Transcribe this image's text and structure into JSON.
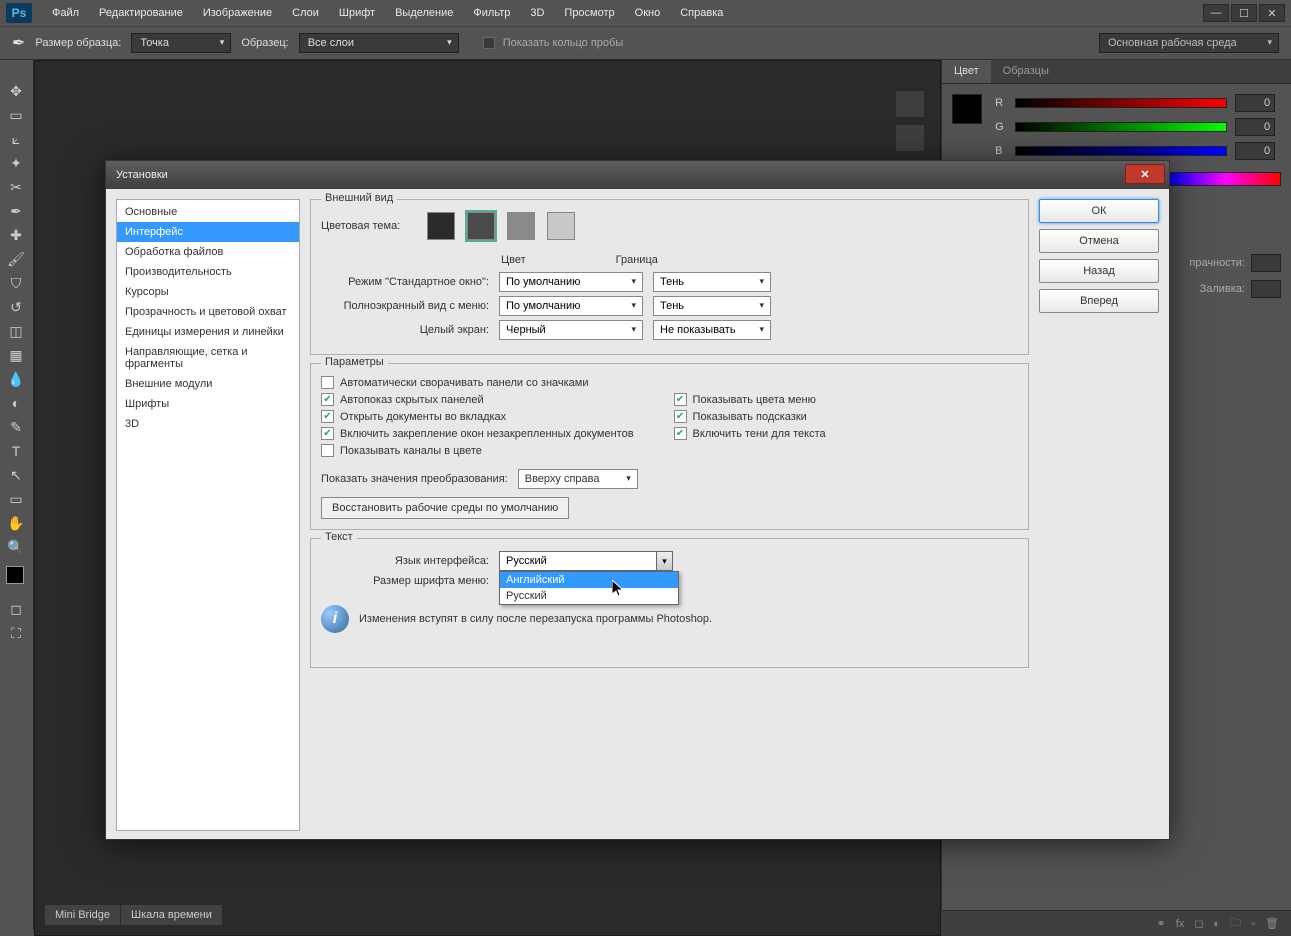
{
  "app": {
    "logo": "Ps"
  },
  "menubar": [
    "Файл",
    "Редактирование",
    "Изображение",
    "Слои",
    "Шрифт",
    "Выделение",
    "Фильтр",
    "3D",
    "Просмотр",
    "Окно",
    "Справка"
  ],
  "optionsbar": {
    "sample_size_label": "Размер образца:",
    "sample_size_value": "Точка",
    "sample_label": "Образец:",
    "sample_value": "Все слои",
    "show_ring_label": "Показать кольцо пробы",
    "workspace_label": "Основная рабочая среда"
  },
  "rightpanel": {
    "tabs": {
      "color": "Цвет",
      "swatches": "Образцы"
    },
    "r_label": "R",
    "g_label": "G",
    "b_label": "B",
    "r_val": "0",
    "g_val": "0",
    "b_val": "0",
    "layers": {
      "opacity_label": "прачности:",
      "fill_label": "Заливка:"
    }
  },
  "bottom_tabs": {
    "mini_bridge": "Mini Bridge",
    "timeline": "Шкала времени"
  },
  "dialog": {
    "title": "Установки",
    "categories": [
      "Основные",
      "Интерфейс",
      "Обработка файлов",
      "Производительность",
      "Курсоры",
      "Прозрачность и цветовой охват",
      "Единицы измерения и линейки",
      "Направляющие, сетка и фрагменты",
      "Внешние модули",
      "Шрифты",
      "3D"
    ],
    "selected_category_index": 1,
    "buttons": {
      "ok": "ОК",
      "cancel": "Отмена",
      "prev": "Назад",
      "next": "Вперед"
    },
    "appearance": {
      "legend": "Внешний вид",
      "theme_label": "Цветовая тема:",
      "col_color": "Цвет",
      "col_border": "Граница",
      "row_standard": "Режим \"Стандартное окно\":",
      "row_fullscreen_menu": "Полноэкранный вид с меню:",
      "row_fullscreen": "Целый экран:",
      "val_default": "По умолчанию",
      "val_shadow": "Тень",
      "val_black": "Черный",
      "val_none": "Не показывать"
    },
    "params": {
      "legend": "Параметры",
      "auto_collapse": "Автоматически сворачивать панели со значками",
      "auto_show": "Автопоказ скрытых панелей",
      "open_tabs": "Открыть документы во вкладках",
      "enable_dock": "Включить закрепление окон незакрепленных документов",
      "show_channels_color": "Показывать каналы в цвете",
      "show_menu_colors": "Показывать цвета меню",
      "show_tooltips": "Показывать подсказки",
      "text_shadows": "Включить тени для текста",
      "transform_label": "Показать значения преобразования:",
      "transform_value": "Вверху справа",
      "restore_btn": "Восстановить рабочие среды по умолчанию"
    },
    "text": {
      "legend": "Текст",
      "lang_label": "Язык интерфейса:",
      "lang_value": "Русский",
      "lang_options": [
        "Английский",
        "Русский"
      ],
      "font_size_label": "Размер шрифта меню:",
      "info_msg": "Изменения вступят в силу после перезапуска программы Photoshop."
    }
  }
}
